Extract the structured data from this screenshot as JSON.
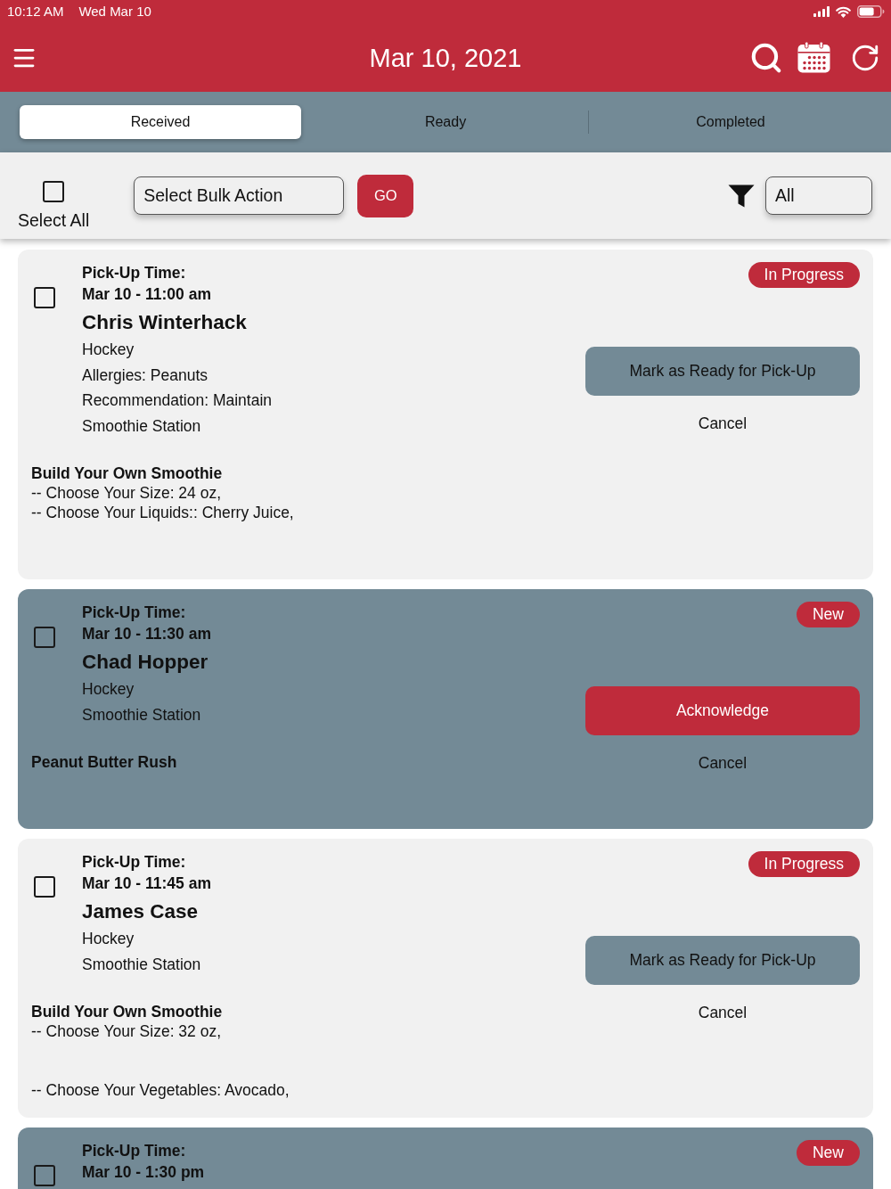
{
  "status_bar": {
    "time": "10:12 AM",
    "date": "Wed Mar 10"
  },
  "header": {
    "title": "Mar 10, 2021"
  },
  "tabs": [
    {
      "label": "Received",
      "selected": true
    },
    {
      "label": "Ready",
      "selected": false
    },
    {
      "label": "Completed",
      "selected": false
    }
  ],
  "toolbar": {
    "select_all": {
      "label": "Select All",
      "checked": false
    },
    "bulk_action": {
      "value": "Select Bulk Action"
    },
    "go_button": "GO",
    "filter": {
      "value": "All"
    }
  },
  "orders": [
    {
      "highlighted": false,
      "checked": false,
      "badge": "In Progress",
      "pickup_label": "Pick-Up Time:",
      "pickup_time": "Mar 10 - 11:00 am",
      "customer": "Chris Winterhack",
      "details": [
        "Hockey",
        "Allergies: Peanuts",
        "Recommendation: Maintain",
        "Smoothie Station"
      ],
      "action": {
        "kind": "mark_ready",
        "label": "Mark as Ready for Pick-Up"
      },
      "cancel": "Cancel",
      "item": {
        "name": "Build Your Own Smoothie",
        "option_groups": [
          [
            "-- Choose Your Size: 24 oz,",
            "-- Choose Your Liquids:: Cherry Juice,"
          ]
        ]
      }
    },
    {
      "highlighted": true,
      "checked": false,
      "badge": "New",
      "pickup_label": "Pick-Up Time:",
      "pickup_time": "Mar 10 - 11:30 am",
      "customer": "Chad Hopper",
      "details": [
        "Hockey",
        "Smoothie Station"
      ],
      "action": {
        "kind": "acknowledge",
        "label": "Acknowledge"
      },
      "cancel": "Cancel",
      "item": {
        "name": "Peanut Butter Rush"
      }
    },
    {
      "highlighted": false,
      "checked": false,
      "badge": "In Progress",
      "pickup_label": "Pick-Up Time:",
      "pickup_time": "Mar 10 - 11:45 am",
      "customer": "James Case",
      "details": [
        "Hockey",
        "Smoothie Station"
      ],
      "action": {
        "kind": "mark_ready",
        "label": "Mark as Ready for Pick-Up"
      },
      "cancel": "Cancel",
      "item": {
        "name": "Build Your Own Smoothie",
        "option_groups": [
          [
            "-- Choose Your Size: 32 oz,"
          ],
          [
            "-- Choose Your Vegetables: Avocado,"
          ]
        ]
      }
    },
    {
      "highlighted": true,
      "checked": false,
      "badge": "New",
      "pickup_label": "Pick-Up Time:",
      "pickup_time": "Mar 10 - 1:30 pm"
    }
  ]
}
